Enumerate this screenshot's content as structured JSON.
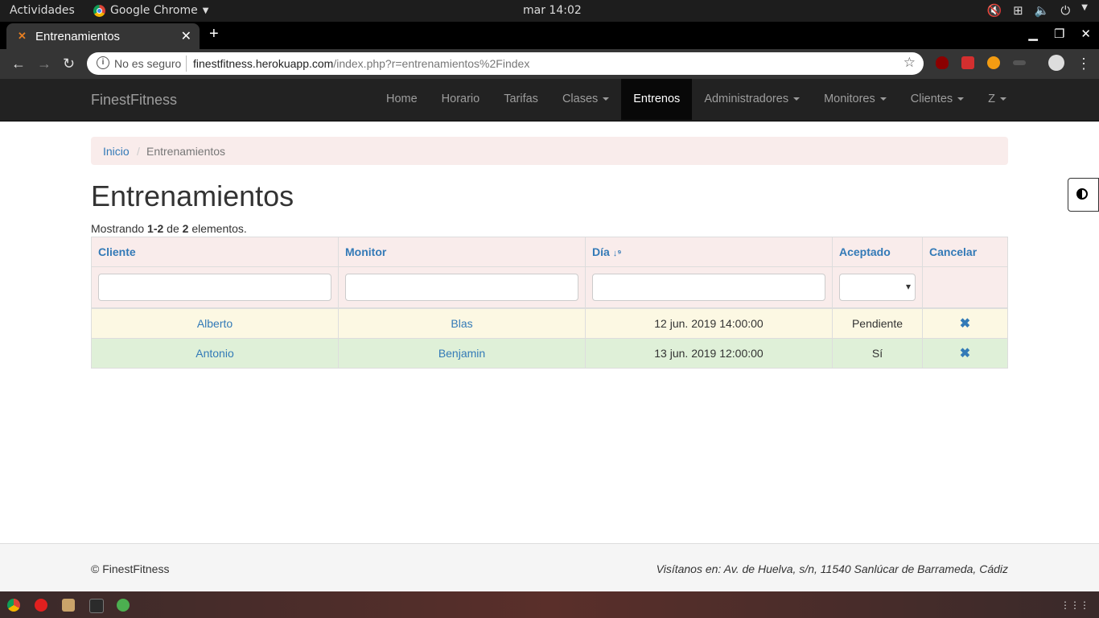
{
  "os": {
    "activities": "Actividades",
    "app_name": "Google Chrome",
    "clock": "mar 14:02"
  },
  "browser": {
    "tab_title": "Entrenamientos",
    "security_label": "No es seguro",
    "url_domain": "finestfitness.herokuapp.com",
    "url_path": "/index.php?r=entrenamientos%2Findex"
  },
  "site": {
    "brand": "FinestFitness",
    "nav": [
      {
        "label": "Home"
      },
      {
        "label": "Horario"
      },
      {
        "label": "Tarifas"
      },
      {
        "label": "Clases"
      },
      {
        "label": "Entrenos"
      },
      {
        "label": "Administradores"
      },
      {
        "label": "Monitores"
      },
      {
        "label": "Clientes"
      },
      {
        "label": "Z"
      }
    ]
  },
  "breadcrumb": {
    "home": "Inicio",
    "separator": "/",
    "current": "Entrenamientos"
  },
  "page": {
    "title": "Entrenamientos",
    "summary_prefix": "Mostrando ",
    "summary_range": "1-2",
    "summary_mid": " de ",
    "summary_total": "2",
    "summary_suffix": " elementos."
  },
  "table": {
    "columns": [
      "Cliente",
      "Monitor",
      "Día",
      "Aceptado",
      "Cancelar"
    ],
    "rows": [
      {
        "cliente": "Alberto",
        "monitor": "Blas",
        "dia": "12 jun. 2019 14:00:00",
        "aceptado": "Pendiente"
      },
      {
        "cliente": "Antonio",
        "monitor": "Benjamin",
        "dia": "13 jun. 2019 12:00:00",
        "aceptado": "Sí"
      }
    ],
    "cancel_glyph": "✖"
  },
  "footer": {
    "left": "© FinestFitness",
    "right": "Visítanos en: Av. de Huelva, s/n, 11540 Sanlúcar de Barrameda, Cádiz"
  },
  "colors": {
    "link": "#337ab7",
    "navbar": "#222222",
    "header_bg": "#f9eceb",
    "row_warning": "#fcf8e3",
    "row_success": "#dff0d8"
  }
}
